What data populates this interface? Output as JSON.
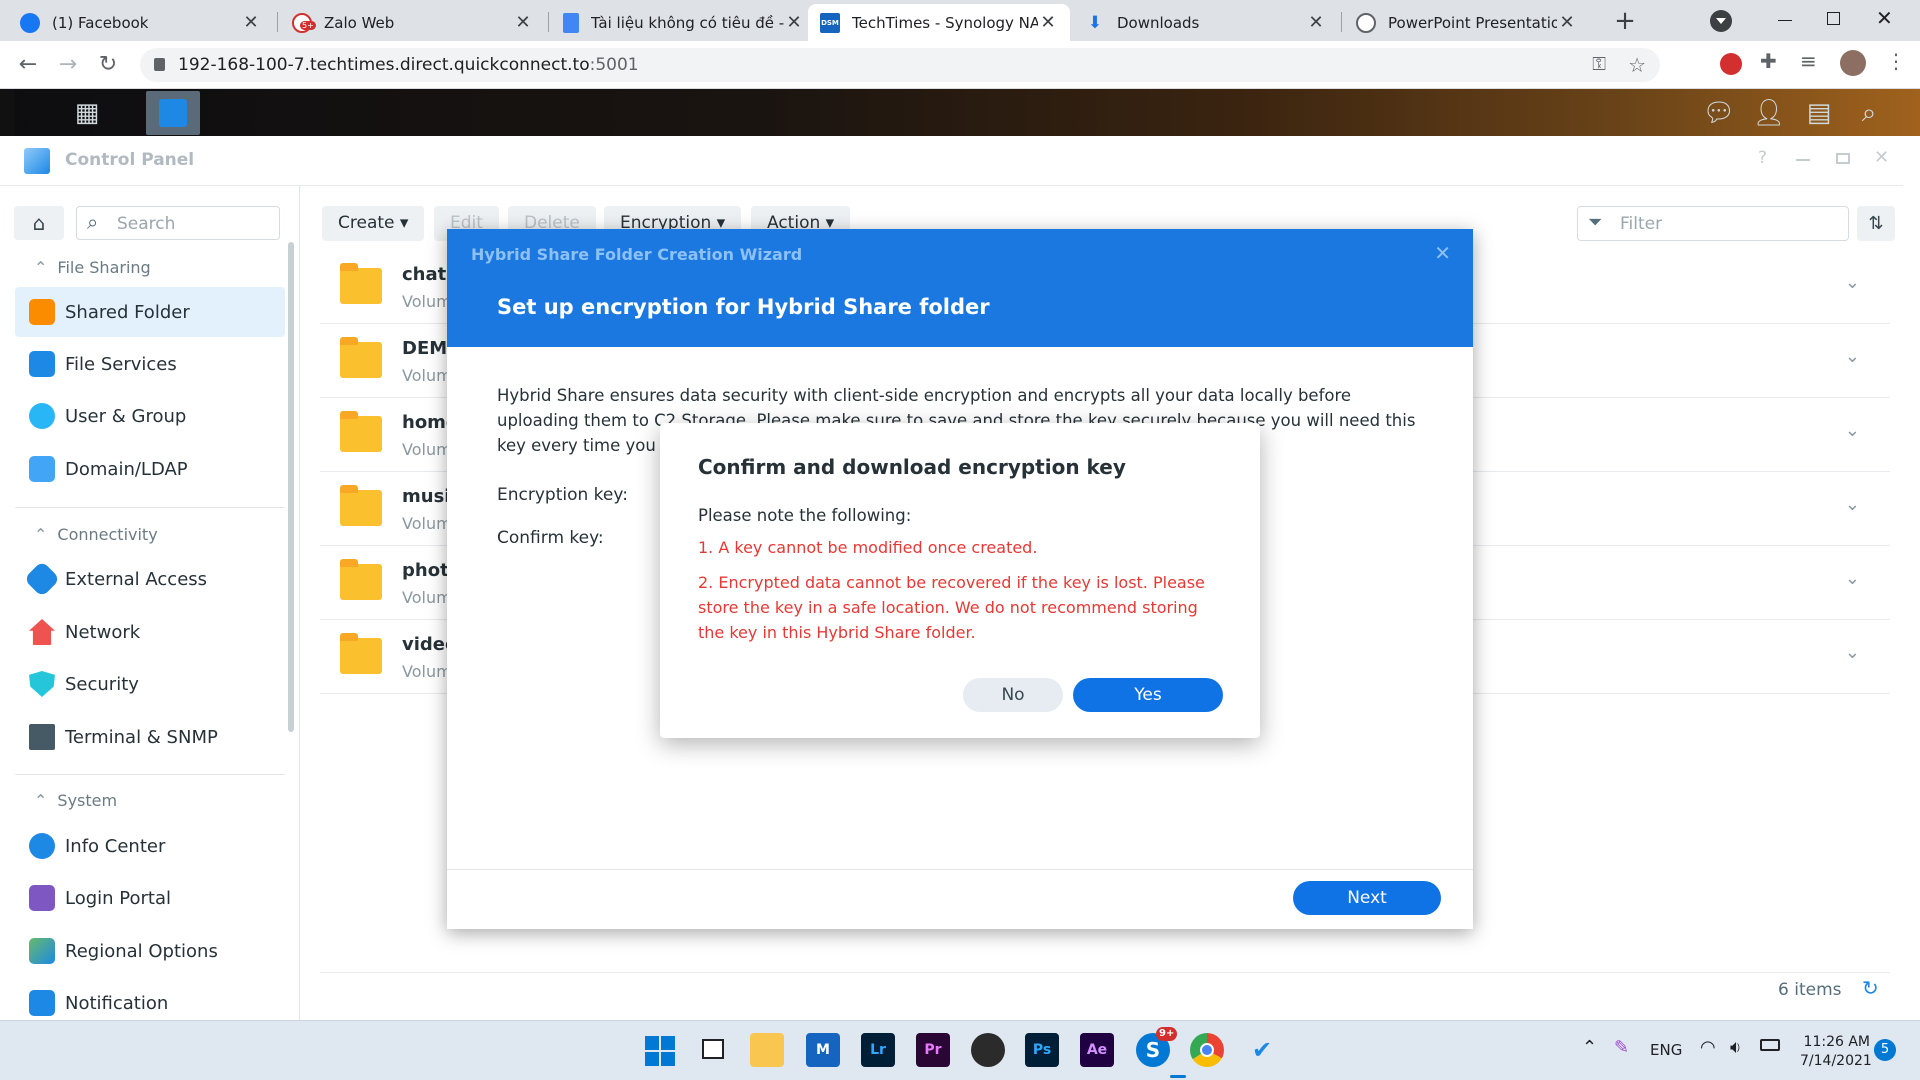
{
  "browser": {
    "tabs": [
      {
        "title": "(1) Facebook",
        "icon": "facebook-icon"
      },
      {
        "title": "Zalo Web",
        "icon": "zalo-icon",
        "badge": "5+"
      },
      {
        "title": "Tài liệu không có tiêu đề - G",
        "icon": "docs-icon"
      },
      {
        "title": "TechTimes - Synology NAS",
        "icon": "dsm-icon",
        "icon_text": "DSM"
      },
      {
        "title": "Downloads",
        "icon": "download-icon"
      },
      {
        "title": "PowerPoint Presentation",
        "icon": "globe-icon"
      }
    ],
    "new_tab": "+",
    "url_host": "192-168-100-7.techtimes.direct.quickconnect.to",
    "url_port": ":5001"
  },
  "control_panel": {
    "title": "Control Panel",
    "help": "?",
    "search_placeholder": "Search",
    "groups": [
      {
        "label": "File Sharing",
        "items": [
          "Shared Folder",
          "File Services",
          "User & Group",
          "Domain/LDAP"
        ]
      },
      {
        "label": "Connectivity",
        "items": [
          "External Access",
          "Network",
          "Security",
          "Terminal & SNMP"
        ]
      },
      {
        "label": "System",
        "items": [
          "Info Center",
          "Login Portal",
          "Regional Options",
          "Notification"
        ]
      }
    ],
    "selected_item": "Shared Folder",
    "toolbar": {
      "create": "Create",
      "edit": "Edit",
      "delete": "Delete",
      "encryption": "Encryption",
      "action": "Action",
      "filter_placeholder": "Filter"
    },
    "folders": [
      {
        "name": "chat",
        "sub": "Volum"
      },
      {
        "name": "DEMC",
        "sub": "Volum"
      },
      {
        "name": "home",
        "sub": "Volum"
      },
      {
        "name": "musi",
        "sub": "Volum"
      },
      {
        "name": "photo",
        "sub": "Volum"
      },
      {
        "name": "video",
        "sub": "Volum"
      }
    ],
    "items_count": "6 items"
  },
  "wizard": {
    "window_title": "Hybrid Share Folder Creation Wizard",
    "heading": "Set up encryption for Hybrid Share folder",
    "desc_line1": "Hybrid Share ensures data security with client-side encryption and encrypts all your data locally before",
    "desc_line2_left": "uploading them to C2 Storage. Please make sure to save and store the key securely because",
    "desc_line2_right": "you will need this",
    "desc_line3": "key every time you",
    "encryption_key_label": "Encryption key:",
    "confirm_key_label": "Confirm key:",
    "next": "Next"
  },
  "confirm_dialog": {
    "title": "Confirm and download encryption key",
    "note": "Please note the following:",
    "point1": "1. A key cannot be modified once created.",
    "point2_line1": "2. Encrypted data cannot be recovered if the key is lost. Please",
    "point2_line2": "store the key in a safe location. We do not recommend storing",
    "point2_line3": "the key in this Hybrid Share folder.",
    "no": "No",
    "yes": "Yes",
    "warning_color": "#e53935"
  },
  "taskbar": {
    "apps": [
      {
        "name": "start",
        "icon": "windows-icon"
      },
      {
        "name": "task-view",
        "icon": "task-view-icon"
      },
      {
        "name": "file-explorer",
        "icon": "folder-icon"
      },
      {
        "name": "app-m",
        "icon": "m-app-icon"
      },
      {
        "name": "lightroom",
        "icon": "lightroom-icon",
        "text": "Lr"
      },
      {
        "name": "premiere",
        "icon": "premiere-icon",
        "text": "Pr"
      },
      {
        "name": "davinci",
        "icon": "davinci-icon"
      },
      {
        "name": "photoshop",
        "icon": "photoshop-icon",
        "text": "Ps"
      },
      {
        "name": "after-effects",
        "icon": "after-effects-icon",
        "text": "Ae"
      },
      {
        "name": "skype",
        "icon": "skype-icon",
        "text": "S",
        "badge": "9+"
      },
      {
        "name": "chrome",
        "icon": "chrome-icon"
      },
      {
        "name": "todo",
        "icon": "todo-icon"
      }
    ],
    "lang": "ENG",
    "time": "11:26 AM",
    "date": "7/14/2021",
    "notifications": "5"
  }
}
